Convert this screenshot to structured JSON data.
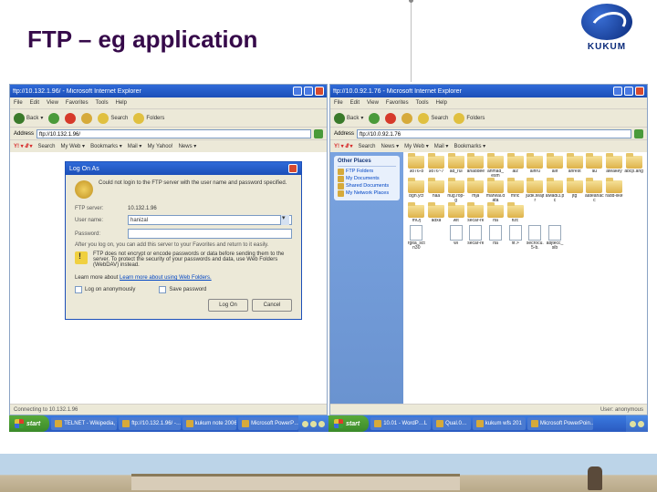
{
  "slide": {
    "title": "FTP – eg application",
    "logo_text": "KUKUM"
  },
  "left_window": {
    "title": "ftp://10.132.1.96/ - Microsoft Internet Explorer",
    "menu": [
      "File",
      "Edit",
      "View",
      "Favorites",
      "Tools",
      "Help"
    ],
    "toolbar": {
      "back": "Back",
      "search": "Search",
      "folders": "Folders"
    },
    "address_label": "Address",
    "address_value": "ftp://10.132.1.96/",
    "linkbar": {
      "yex": "Y! ▾ 𝓔 ▾",
      "search": "Search",
      "myweb": "My Web ▾",
      "bookmarks": "Bookmarks ▾",
      "mail": "Mail ▾",
      "myyahoo": "My Yahoo!",
      "news": "News ▾"
    },
    "status": "Connecting to 10.132.1.96"
  },
  "dialog": {
    "title": "Log On As",
    "message": "Could not login to the FTP server with the user name and password specified.",
    "server_label": "FTP server:",
    "server_value": "10.132.1.96",
    "user_label": "User name:",
    "user_value": "hanizal",
    "pass_label": "Password:",
    "pass_value": "",
    "hint": "After you log on, you can add this server to your Favorites and return to it easily.",
    "warning": "FTP does not encrypt or encode passwords or data before sending them to the server. To protect the security of your passwords and data, use Web Folders (WebDAV) instead.",
    "learn_more": "Learn more about using Web Folders.",
    "anon": "Log on anonymously",
    "save": "Save password",
    "logon_btn": "Log On",
    "cancel_btn": "Cancel"
  },
  "right_window": {
    "title": "ftp://10.0.92.1.76 - Microsoft Internet Explorer",
    "address_value": "ftp://10.0.92.1.76",
    "sidebar": {
      "header": "Other Places",
      "items": [
        "FTP Folders",
        "My Documents",
        "Shared Documents",
        "My Network Places"
      ]
    },
    "folders_row1": [
      "9876-8",
      "9876~7",
      "ad_rul",
      "ahaddee",
      "ahmad_esm",
      "aiz",
      "aihru",
      "alif",
      "anrest",
      "au",
      "ateakey",
      "abcp.ang"
    ],
    "folders_row2": [
      "bgh.yct",
      "haa",
      "hug.rop-g",
      "mja",
      "marwal.data",
      "mric",
      "judk.teajtr",
      "aMadi3.pc",
      "jtg",
      "aateanacc",
      "radd-like",
      ""
    ],
    "folders_row3": [
      "mOj",
      "adxa",
      "wit",
      "secar-rk",
      "rta",
      "fizc",
      "",
      "",
      "",
      "",
      "",
      ""
    ],
    "files_row": [
      "rgita_sctn30",
      "",
      "wi",
      "secar-rk",
      "rta",
      "fif.>",
      "secrocu.5-b.",
      "abjtecc_sib",
      "",
      "",
      "",
      ""
    ],
    "status": "User: anonymous"
  },
  "taskbar_left": {
    "start": "start",
    "items": [
      "TELNET - Wikipedia, t…",
      "ftp://10.132.1.96/ -…",
      "kukum note 2006",
      "Microsoft PowerP…"
    ]
  },
  "taskbar_right": {
    "start": "start",
    "items": [
      "10.01 - WordP…L",
      "Qual.0…",
      "kukum wfs 201",
      "Microsoft PowerPoin…"
    ]
  }
}
